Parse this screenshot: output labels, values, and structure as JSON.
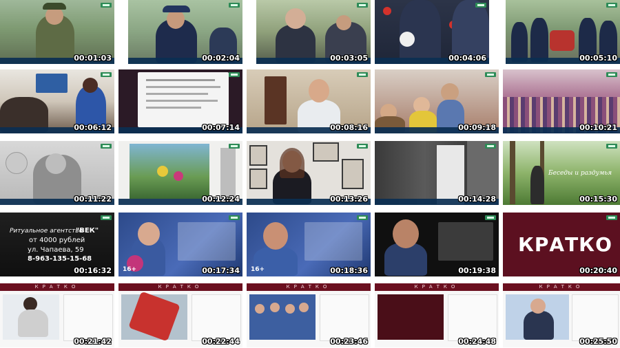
{
  "timestamps": [
    "00:01:03",
    "00:02:04",
    "00:03:05",
    "00:04:06",
    "00:05:10",
    "00:06:12",
    "00:07:14",
    "00:08:16",
    "00:09:18",
    "00:10:21",
    "00:11:22",
    "00:12:24",
    "00:13:26",
    "00:14:28",
    "00:15:30",
    "00:16:32",
    "00:17:34",
    "00:18:36",
    "00:19:38",
    "00:20:40",
    "00:21:42",
    "00:22:44",
    "00:23:46",
    "00:24:48",
    "00:25:50"
  ],
  "overlays": {
    "ritual_agency_line1": "Ритуальное агентство",
    "ritual_agency_name": "\"ВЕК\"",
    "ritual_price": "от 4000 рублей",
    "ritual_street": "ул. Чапаева, 59",
    "ritual_phone": "8-963-135-15-68",
    "kratko_big": "КРАТКО",
    "kratko_header": "КРАТКО",
    "poem_caption": "Беседы и раздумья",
    "age_rating": "16+"
  },
  "colors": {
    "ticker": "#0b2f52",
    "kratko_banner": "#6b1020",
    "logo_green": "#2e8b57"
  }
}
